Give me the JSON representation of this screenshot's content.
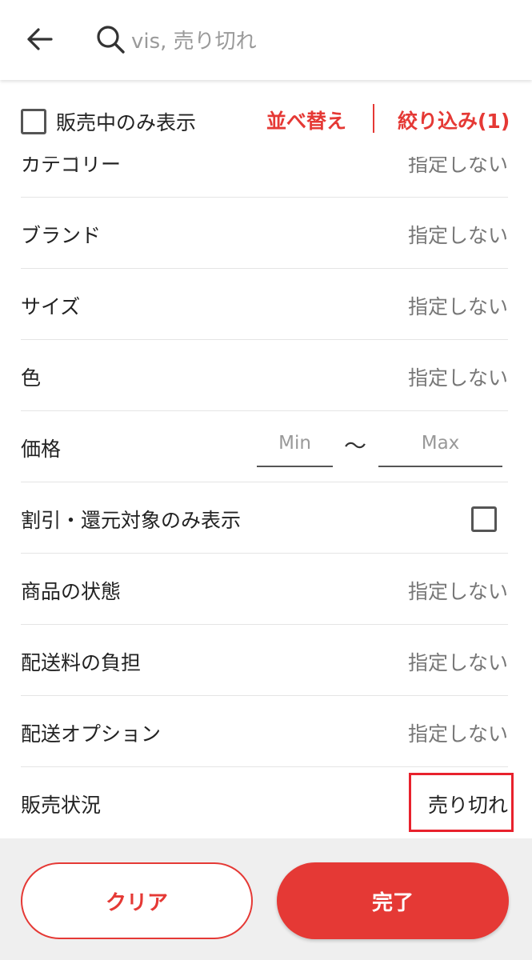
{
  "header": {
    "search_placeholder": "vis, 売り切れ"
  },
  "filter_bar": {
    "on_sale_only_label": "販売中のみ表示",
    "on_sale_only_checked": false,
    "sort_label": "並べ替え",
    "refine_label": "絞り込み(1)"
  },
  "filters": {
    "category": {
      "label": "カテゴリー",
      "value": "指定しない"
    },
    "brand": {
      "label": "ブランド",
      "value": "指定しない"
    },
    "size": {
      "label": "サイズ",
      "value": "指定しない"
    },
    "color": {
      "label": "色",
      "value": "指定しない"
    },
    "price": {
      "label": "価格",
      "min_placeholder": "Min",
      "max_placeholder": "Max",
      "separator": "〜"
    },
    "discount": {
      "label": "割引・還元対象のみ表示",
      "checked": false
    },
    "condition": {
      "label": "商品の状態",
      "value": "指定しない"
    },
    "shipping_fee": {
      "label": "配送料の負担",
      "value": "指定しない"
    },
    "shipping_option": {
      "label": "配送オプション",
      "value": "指定しない"
    },
    "sales_status": {
      "label": "販売状況",
      "value": "売り切れ"
    }
  },
  "footer": {
    "clear_label": "クリア",
    "done_label": "完了"
  },
  "colors": {
    "accent": "#e53935",
    "highlight_box": "#e8222d"
  }
}
